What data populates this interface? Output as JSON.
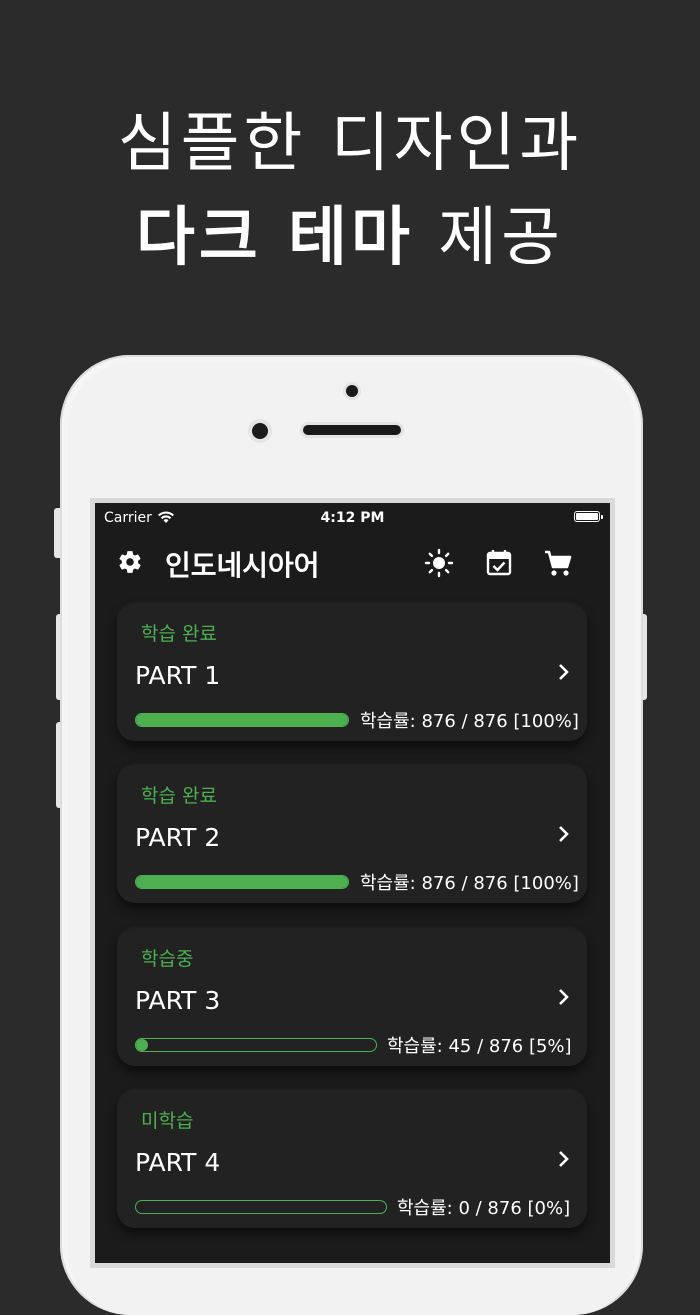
{
  "promo": {
    "line1": "심플한 디자인과",
    "line2_bold": "다크 테마",
    "line2_light": "제공"
  },
  "status_bar": {
    "carrier": "Carrier",
    "time": "4:12 PM"
  },
  "app": {
    "title": "인도네시아어",
    "icons": [
      "gear-icon",
      "brightness-icon",
      "calendar-check-icon",
      "cart-icon"
    ],
    "accent_color": "#4caf50"
  },
  "parts": [
    {
      "status": "학습 완료",
      "name": "PART 1",
      "progress_text": "학습률: 876 / 876 [100%]",
      "progress": 1.0
    },
    {
      "status": "학습 완료",
      "name": "PART 2",
      "progress_text": "학습률: 876 / 876 [100%]",
      "progress": 1.0
    },
    {
      "status": "학습중",
      "name": "PART 3",
      "progress_text": "학습률: 45 / 876 [5%]",
      "progress": 0.05
    },
    {
      "status": "미학습",
      "name": "PART 4",
      "progress_text": "학습률: 0 / 876 [0%]",
      "progress": 0.0
    }
  ]
}
